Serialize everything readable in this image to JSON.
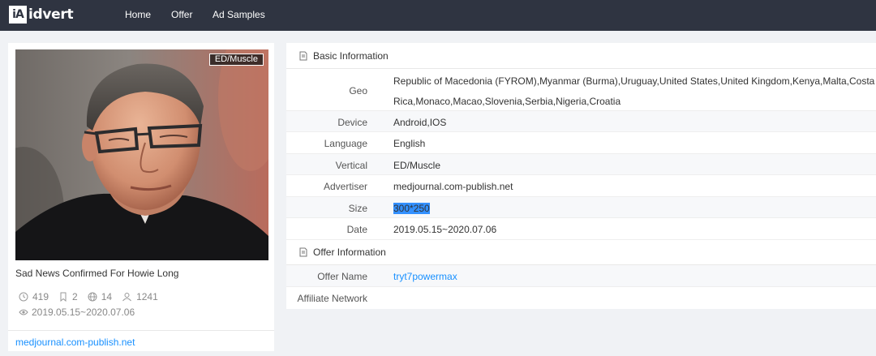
{
  "logo": {
    "mark": "iA",
    "text": "idvert"
  },
  "nav": [
    "Home",
    "Offer",
    "Ad Samples"
  ],
  "ad": {
    "category_tag": "ED/Muscle",
    "title": "Sad News Confirmed For Howie Long",
    "stats": {
      "days": "419",
      "ads": "2",
      "geos": "14",
      "heat": "1241"
    },
    "date_range": "2019.05.15~2020.07.06",
    "advertiser_link": "medjournal.com-publish.net"
  },
  "basic_info": {
    "heading": "Basic Information",
    "geo_label": "Geo",
    "geo_line1": "Republic of Macedonia (FYROM),Myanmar (Burma),Uruguay,United States,United Kingdom,Kenya,Malta,Costa",
    "geo_line2": "Rica,Monaco,Macao,Slovenia,Serbia,Nigeria,Croatia",
    "device_label": "Device",
    "device": "Android,IOS",
    "language_label": "Language",
    "language": "English",
    "vertical_label": "Vertical",
    "vertical": "ED/Muscle",
    "advertiser_label": "Advertiser",
    "advertiser": "medjournal.com-publish.net",
    "size_label": "Size",
    "size": "300*250",
    "date_label": "Date",
    "date": "2019.05.15~2020.07.06"
  },
  "offer_info": {
    "heading": "Offer Information",
    "offer_name_label": "Offer Name",
    "offer_name": "tryt7powermax",
    "affiliate_label": "Affiliate Network",
    "affiliate": ""
  }
}
